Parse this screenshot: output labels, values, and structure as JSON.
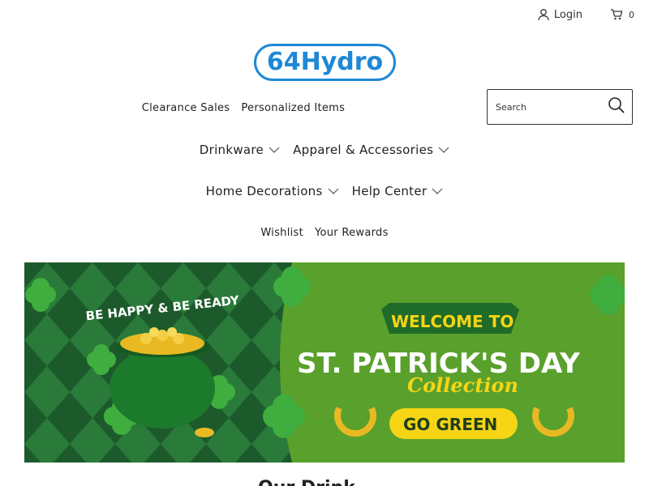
{
  "topbar": {
    "login_label": "Login",
    "cart_count": "0"
  },
  "logo": {
    "text": "64Hydro"
  },
  "search": {
    "placeholder": "Search"
  },
  "nav": {
    "row1": [
      "Clearance Sales",
      "Personalized Items"
    ],
    "row2": [
      {
        "label": "Drinkware",
        "has_dropdown": true
      },
      {
        "label": "Apparel & Accessories",
        "has_dropdown": true
      }
    ],
    "row3": [
      {
        "label": "Home Decorations",
        "has_dropdown": true
      },
      {
        "label": "Help Center",
        "has_dropdown": true
      }
    ],
    "row4": [
      "Wishlist",
      "Your Rewards"
    ]
  },
  "banner": {
    "tagline": "BE HAPPY & BE READY",
    "welcome": "WELCOME TO",
    "headline": "ST. PATRICK'S DAY",
    "subhead": "Collection",
    "cta": "GO GREEN"
  },
  "colors": {
    "brand_blue": "#1e88d6",
    "banner_green": "#5aa02c",
    "dark_green": "#1f6b2a",
    "cta_yellow": "#f5d514"
  },
  "below": {
    "title_partial": "Our Drink"
  }
}
